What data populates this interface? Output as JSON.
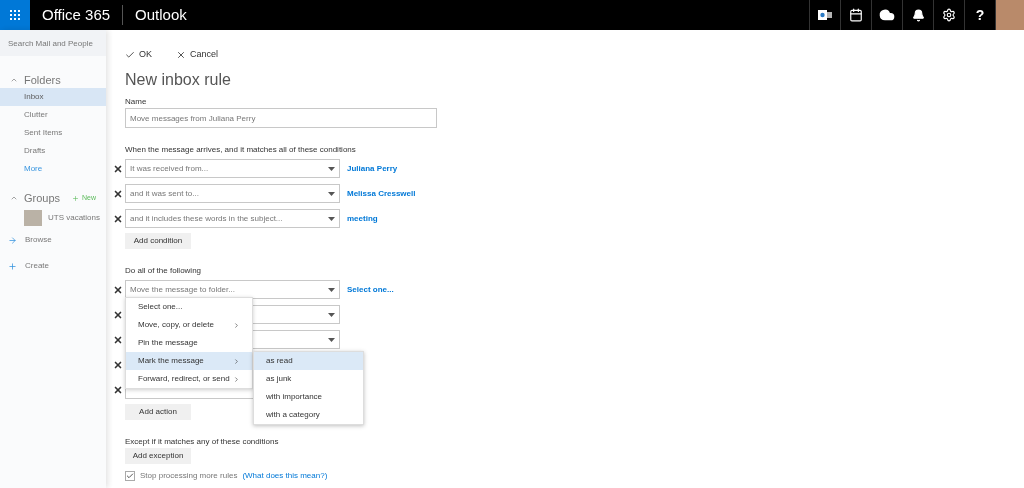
{
  "top_bar": {
    "brand": "Office 365",
    "app": "Outlook",
    "help": "?"
  },
  "sidebar": {
    "search_placeholder": "Search Mail and People",
    "folders_title": "Folders",
    "folders": [
      {
        "label": "Inbox",
        "selected": true
      },
      {
        "label": "Clutter",
        "selected": false
      },
      {
        "label": "Sent Items",
        "selected": false
      },
      {
        "label": "Drafts",
        "selected": false
      }
    ],
    "more": "More",
    "groups_title": "Groups",
    "new_label": "New",
    "groups": [
      {
        "label": "UTS vacations"
      }
    ],
    "browse": "Browse",
    "create": "Create"
  },
  "toolbar": {
    "ok": "OK",
    "cancel": "Cancel"
  },
  "title": "New inbox rule",
  "name_label": "Name",
  "name_value": "Move messages from Juliana Perry",
  "conditions_label": "When the message arrives, and it matches all of these conditions",
  "conditions": [
    {
      "select": "It was received from...",
      "value": "Juliana Perry"
    },
    {
      "select": "and it was sent to...",
      "value": "Melissa Cresswell"
    },
    {
      "select": "and it includes these words in the subject...",
      "value": "meeting"
    }
  ],
  "add_condition": "Add condition",
  "actions_label": "Do all of the following",
  "actions": [
    {
      "kind": "dropdown",
      "select": "Move the message to folder...",
      "value": "Select one..."
    },
    {
      "kind": "dropdown"
    },
    {
      "kind": "dropdown"
    },
    {
      "kind": "dropdown"
    },
    {
      "kind": "dropdown"
    }
  ],
  "add_action": "Add action",
  "menu": [
    {
      "label": "Select one...",
      "submenu": false,
      "selected": false
    },
    {
      "label": "Move, copy, or delete",
      "submenu": true,
      "selected": false
    },
    {
      "label": "Pin the message",
      "submenu": false,
      "selected": false
    },
    {
      "label": "Mark the message",
      "submenu": true,
      "selected": true
    },
    {
      "label": "Forward, redirect, or send",
      "submenu": true,
      "selected": false
    }
  ],
  "submenu": [
    {
      "label": "as read",
      "selected": true
    },
    {
      "label": "as junk",
      "selected": false
    },
    {
      "label": "with importance",
      "selected": false
    },
    {
      "label": "with a category",
      "selected": false
    }
  ],
  "exceptions_label": "Except if it matches any of these conditions",
  "add_exception": "Add exception",
  "stop_processing": {
    "label": "Stop processing more rules",
    "checked": true,
    "help": "(What does this mean?)"
  }
}
